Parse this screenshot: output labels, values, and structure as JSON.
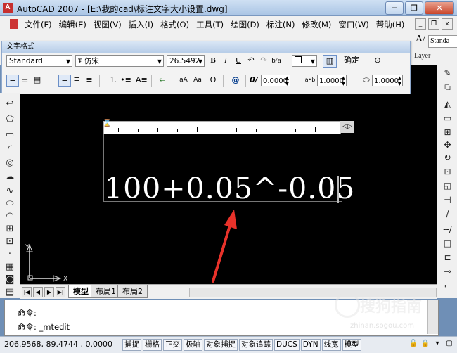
{
  "window": {
    "title": "AutoCAD 2007 - [E:\\我的cad\\标注文字大小设置.dwg]",
    "minimize": "─",
    "restore": "❐",
    "close": "✕"
  },
  "menu": {
    "items": [
      "文件(F)",
      "编辑(E)",
      "视图(V)",
      "插入(I)",
      "格式(O)",
      "工具(T)",
      "绘图(D)",
      "标注(N)",
      "修改(M)",
      "窗口(W)",
      "帮助(H)"
    ]
  },
  "right_top": {
    "style_value": "Standa",
    "layer_label": "Layer"
  },
  "text_format": {
    "title": "文字格式",
    "style": "Standard",
    "font": "仿宋",
    "height": "26.5492",
    "bold": "B",
    "italic": "I",
    "underline": "U",
    "ok_label": "确定",
    "oblique": "0.0000",
    "tracking": "1.0000",
    "width_factor": "1.0000"
  },
  "editor": {
    "mtext": "100+0.05^-0.05"
  },
  "tabs": {
    "items": [
      "模型",
      "布局1",
      "布局2"
    ]
  },
  "command": {
    "line1": "命令:",
    "line2": "命令: _mtedit"
  },
  "status": {
    "coords": "206.9568, 89.4744 , 0.0000",
    "buttons": [
      "捕捉",
      "栅格",
      "正交",
      "极轴",
      "对象捕捉",
      "对象追踪",
      "DUCS",
      "DYN",
      "线宽",
      "模型"
    ]
  },
  "watermark": {
    "text": "搜狗指南",
    "url": "zhinan.sogou.com"
  },
  "colors": {
    "canvas": "#000000",
    "arrow": "#e8322a",
    "titlebar": "#b9d0ec"
  }
}
